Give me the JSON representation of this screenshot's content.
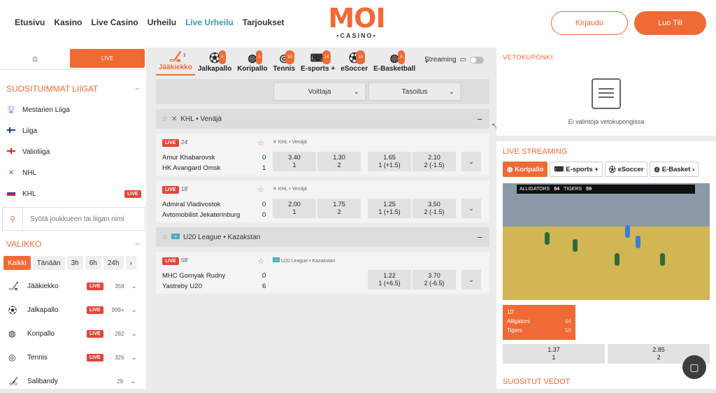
{
  "header": {
    "nav": [
      "Etusivu",
      "Kasino",
      "Live Casino",
      "Urheilu",
      "Live Urheilu",
      "Tarjoukset"
    ],
    "active_nav": "Live Urheilu",
    "logo_main": "MOI",
    "logo_sub": "•CASINO•",
    "login": "Kirjaudu",
    "register": "Luo Tili"
  },
  "left": {
    "live_tab": "LIVE",
    "popular_title": "SUOSITUIMMAT LIIGAT",
    "popular_toggle": "−",
    "leagues": [
      {
        "name": "Mestarien Liiga",
        "icon": "trophy-icon",
        "live": ""
      },
      {
        "name": "Liiga",
        "icon": "finland-flag-icon",
        "live": ""
      },
      {
        "name": "Valioliiga",
        "icon": "england-flag-icon",
        "live": ""
      },
      {
        "name": "NHL",
        "icon": "hockey-sticks-icon",
        "live": ""
      },
      {
        "name": "KHL",
        "icon": "russia-flag-icon",
        "live": "LIVE"
      }
    ],
    "search_placeholder": "Syötä joukkueen tai liigan nimi",
    "menu_title": "VALIKKO",
    "menu_toggle": "−",
    "time_filters": [
      "Kaikki",
      "Tänään",
      "3h",
      "6h",
      "24h",
      "›"
    ],
    "sports": [
      {
        "name": "Jääkiekko",
        "live": "LIVE",
        "count": "359"
      },
      {
        "name": "Jalkapallo",
        "live": "LIVE",
        "count": "999+"
      },
      {
        "name": "Koripallo",
        "live": "LIVE",
        "count": "282"
      },
      {
        "name": "Tennis",
        "live": "LIVE",
        "count": "326"
      },
      {
        "name": "Salibandy",
        "live": "",
        "count": "29"
      }
    ]
  },
  "middle": {
    "sport_tabs": [
      {
        "label": "Jääkiekko",
        "badge": "3"
      },
      {
        "label": "Jalkapallo",
        "badge": "8"
      },
      {
        "label": "Koripallo",
        "badge": "5"
      },
      {
        "label": "Tennis",
        "badge": "33"
      },
      {
        "label": "E-sports +",
        "badge": "14"
      },
      {
        "label": "eSoccer",
        "badge": "15"
      },
      {
        "label": "E-Basketball",
        "badge": "6"
      }
    ],
    "streaming_label": "Streaming",
    "select_winner": "Voittaja",
    "select_handicap": "Tasoitus",
    "groups": [
      {
        "league": "KHL • Venäjä",
        "matches": [
          {
            "live": "LIVE",
            "minute": "24'",
            "league": "KHL • Venäjä",
            "home": "Amur Khabarovsk",
            "away": "HK Avangard Omsk",
            "score_home": "0",
            "score_away": "1",
            "odds": [
              {
                "v": "3.40",
                "l": "1"
              },
              {
                "v": "1.30",
                "l": "2"
              },
              {
                "v": "1.65",
                "l": "1 (+1.5)"
              },
              {
                "v": "2.10",
                "l": "2 (-1.5)"
              }
            ]
          },
          {
            "live": "LIVE",
            "minute": "18'",
            "league": "KHL • Venäjä",
            "home": "Admiral Vladivostok",
            "away": "Avtomobilist Jekaterinburg",
            "score_home": "0",
            "score_away": "0",
            "odds": [
              {
                "v": "2.00",
                "l": "1"
              },
              {
                "v": "1.75",
                "l": "2"
              },
              {
                "v": "1.25",
                "l": "1 (+1.5)"
              },
              {
                "v": "3.50",
                "l": "2 (-1.5)"
              }
            ]
          }
        ]
      },
      {
        "league": "U20 League • Kazakstan",
        "matches": [
          {
            "live": "LIVE",
            "minute": "58'",
            "league": "U20 League • Kazakstan",
            "home": "MHC Gornyak Rudny",
            "away": "Yastreby U20",
            "score_home": "0",
            "score_away": "6",
            "odds": [
              {
                "v": "1.22",
                "l": "1 (+6.5)"
              },
              {
                "v": "3.70",
                "l": "2 (-6.5)"
              }
            ]
          }
        ]
      }
    ]
  },
  "right": {
    "slip_title": "VETOKUPONKI",
    "slip_empty": "Ei valintoja vetokupongissa",
    "live_title": "LIVE STREAMING",
    "stream_tabs": [
      "Koripallo",
      "E-sports +",
      "eSoccer",
      "E-Basket ›"
    ],
    "scoreboard": {
      "home": "ALLIGATORS",
      "home_score": "64",
      "away": "TIGERS",
      "away_score": "59"
    },
    "minute": "10'",
    "teams": [
      {
        "name": "Alligators",
        "score": "64"
      },
      {
        "name": "Tigers",
        "score": "59"
      }
    ],
    "odds": [
      {
        "v": "1.37",
        "l": "1"
      },
      {
        "v": "2.85",
        "l": "2"
      }
    ],
    "popular_bets": "SUOSITUT VEDOT"
  },
  "colors": {
    "accent": "#f06a35",
    "live": "#e8443a",
    "nav_active": "#3a9aa8"
  }
}
